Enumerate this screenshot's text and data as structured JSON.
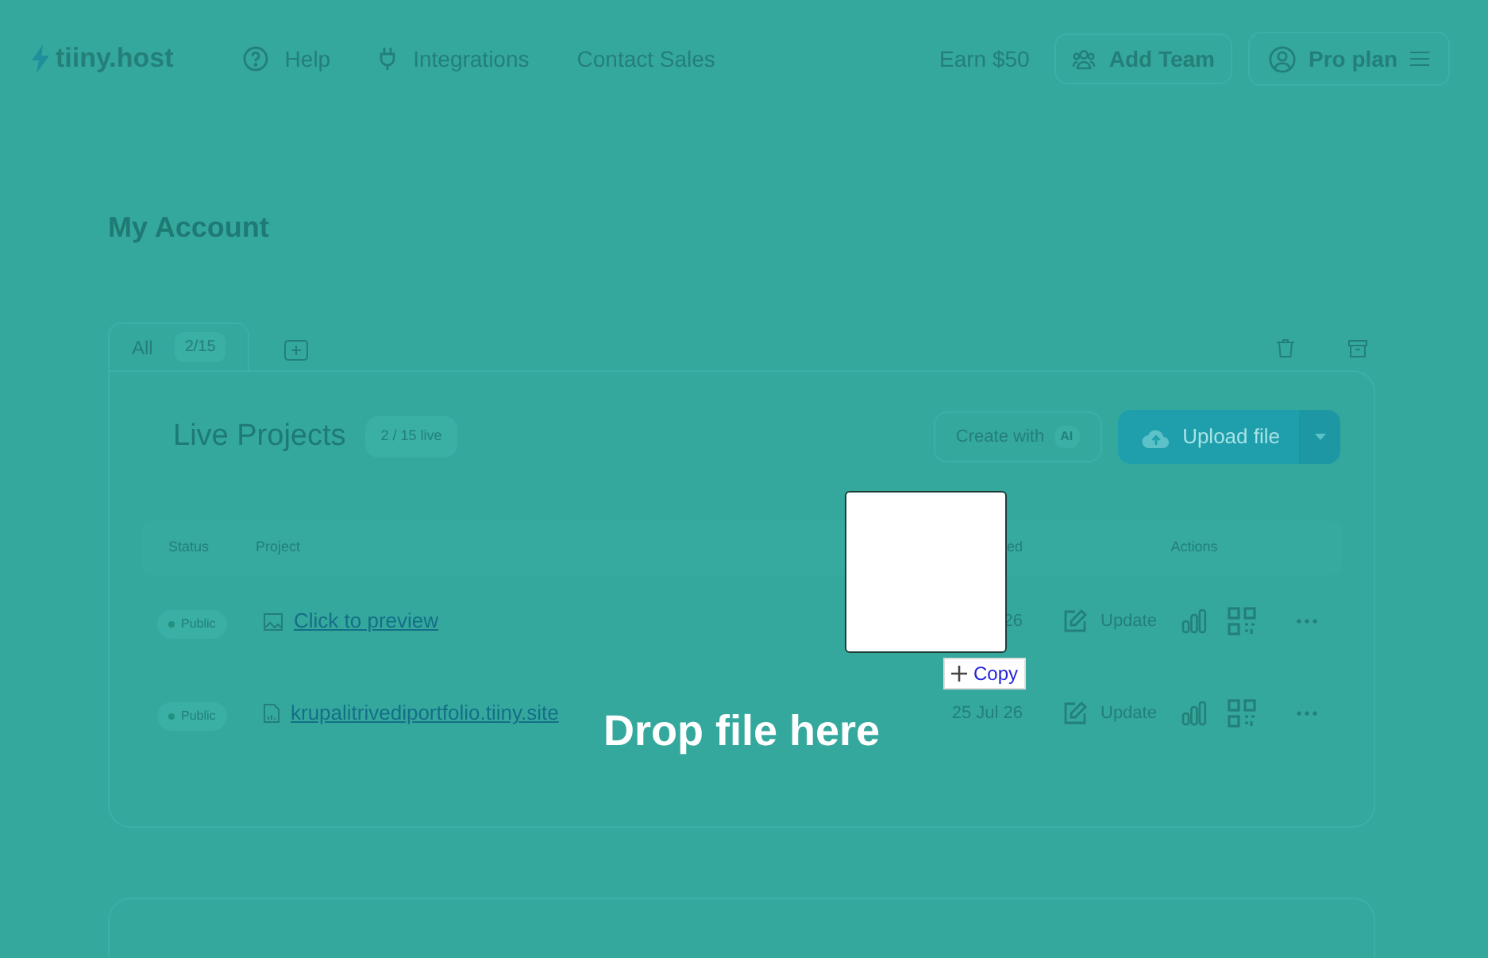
{
  "header": {
    "logo": "tiiny.host",
    "nav": [
      {
        "kind": "help",
        "label": "Help"
      },
      {
        "kind": "plug",
        "label": "Integrations"
      },
      {
        "kind": "plain",
        "label": "Contact Sales"
      }
    ],
    "earn": "Earn $50",
    "add_team": "Add Team",
    "plan": "Pro plan"
  },
  "page_title": "My Account",
  "tabs": [
    {
      "label": "All",
      "count": "2/15",
      "selected": true
    }
  ],
  "projects": {
    "title": "Live Projects",
    "badge": "2 / 15 live",
    "create_button": "Create with",
    "ai_badge": "AI",
    "upload_button": "Upload file",
    "columns": [
      "Status",
      "Project",
      "ed",
      "Actions"
    ],
    "rows": [
      {
        "status": "Public",
        "kind": "image",
        "project": "Click to preview",
        "date": "26",
        "update": "Update"
      },
      {
        "status": "Public",
        "kind": "file",
        "project": "krupalitrivediportfolio.tiiny.site",
        "date": "25 Jul 26",
        "update": "Update"
      }
    ]
  },
  "drag": {
    "copy_label": "Copy"
  },
  "drop_message": "Drop file here"
}
